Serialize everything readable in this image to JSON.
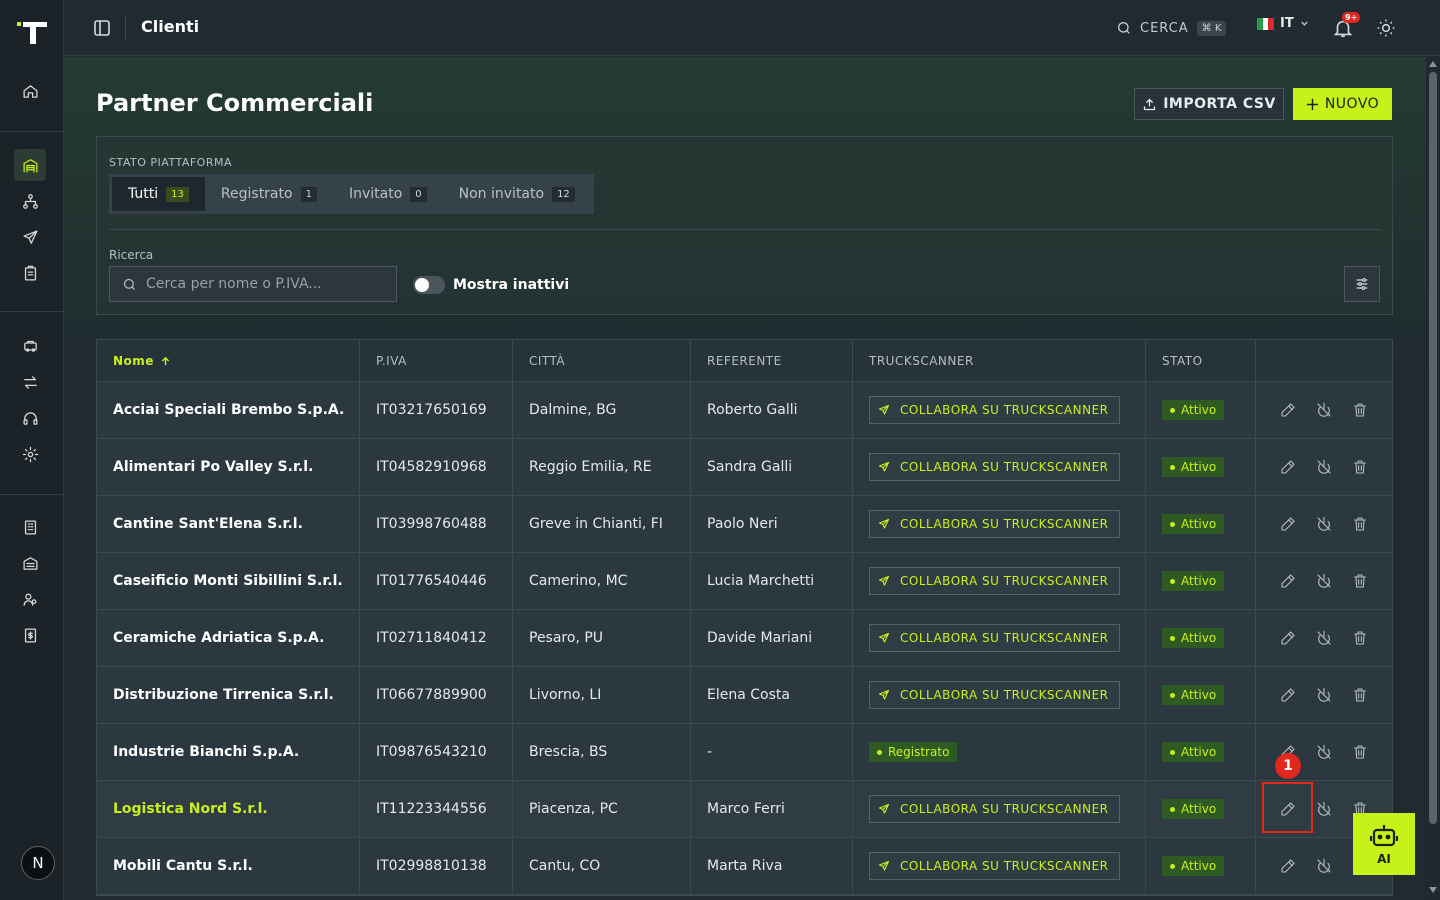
{
  "topbar": {
    "page_title": "Clienti",
    "search_label": "CERCA",
    "search_shortcut": "⌘ K",
    "language": "IT",
    "notifications_badge": "9+"
  },
  "header": {
    "title": "Partner Commerciali",
    "import_label": "IMPORTA CSV",
    "new_label": "NUOVO"
  },
  "filters": {
    "platform_label": "STATO PIATTAFORMA",
    "tabs": [
      {
        "label": "Tutti",
        "count": "13"
      },
      {
        "label": "Registrato",
        "count": "1"
      },
      {
        "label": "Invitato",
        "count": "0"
      },
      {
        "label": "Non invitato",
        "count": "12"
      }
    ],
    "search_label": "Ricerca",
    "search_placeholder": "Cerca per nome o P.IVA...",
    "show_inactive_label": "Mostra inattivi",
    "show_inactive": false
  },
  "table": {
    "columns": [
      "Nome",
      "P.IVA",
      "CITTÀ",
      "REFERENTE",
      "TRUCKSCANNER",
      "STATO",
      ""
    ],
    "sorted_column": "Nome",
    "rows": [
      {
        "name": "Acciai Speciali Brembo S.p.A.",
        "piva": "IT03217650169",
        "city": "Dalmine, BG",
        "contact": "Roberto Galli",
        "truckscanner": "COLLABORA SU TRUCKSCANNER",
        "status": "Attivo"
      },
      {
        "name": "Alimentari Po Valley S.r.l.",
        "piva": "IT04582910968",
        "city": "Reggio Emilia, RE",
        "contact": "Sandra Galli",
        "truckscanner": "COLLABORA SU TRUCKSCANNER",
        "status": "Attivo"
      },
      {
        "name": "Cantine Sant'Elena S.r.l.",
        "piva": "IT03998760488",
        "city": "Greve in Chianti, FI",
        "contact": "Paolo Neri",
        "truckscanner": "COLLABORA SU TRUCKSCANNER",
        "status": "Attivo"
      },
      {
        "name": "Caseificio Monti Sibillini S.r.l.",
        "piva": "IT01776540446",
        "city": "Camerino, MC",
        "contact": "Lucia Marchetti",
        "truckscanner": "COLLABORA SU TRUCKSCANNER",
        "status": "Attivo"
      },
      {
        "name": "Ceramiche Adriatica S.p.A.",
        "piva": "IT02711840412",
        "city": "Pesaro, PU",
        "contact": "Davide Mariani",
        "truckscanner": "COLLABORA SU TRUCKSCANNER",
        "status": "Attivo"
      },
      {
        "name": "Distribuzione Tirrenica S.r.l.",
        "piva": "IT06677889900",
        "city": "Livorno, LI",
        "contact": "Elena Costa",
        "truckscanner": "COLLABORA SU TRUCKSCANNER",
        "status": "Attivo"
      },
      {
        "name": "Industrie Bianchi S.p.A.",
        "piva": "IT09876543210",
        "city": "Brescia, BS",
        "contact": "-",
        "truckscanner": "Registrato",
        "status": "Attivo"
      },
      {
        "name": "Logistica Nord S.r.l.",
        "piva": "IT11223344556",
        "city": "Piacenza, PC",
        "contact": "Marco Ferri",
        "truckscanner": "COLLABORA SU TRUCKSCANNER",
        "status": "Attivo"
      },
      {
        "name": "Mobili Cantu S.r.l.",
        "piva": "IT02998810138",
        "city": "Cantu, CO",
        "contact": "Marta Riva",
        "truckscanner": "COLLABORA SU TRUCKSCANNER",
        "status": "Attivo"
      }
    ]
  },
  "annotation": {
    "number": "1"
  },
  "ai_button": {
    "label": "AI"
  },
  "user": {
    "initial": "N"
  },
  "colors": {
    "accent": "#c6f21a",
    "background": "#1f2a32",
    "marker": "#e0281f"
  }
}
